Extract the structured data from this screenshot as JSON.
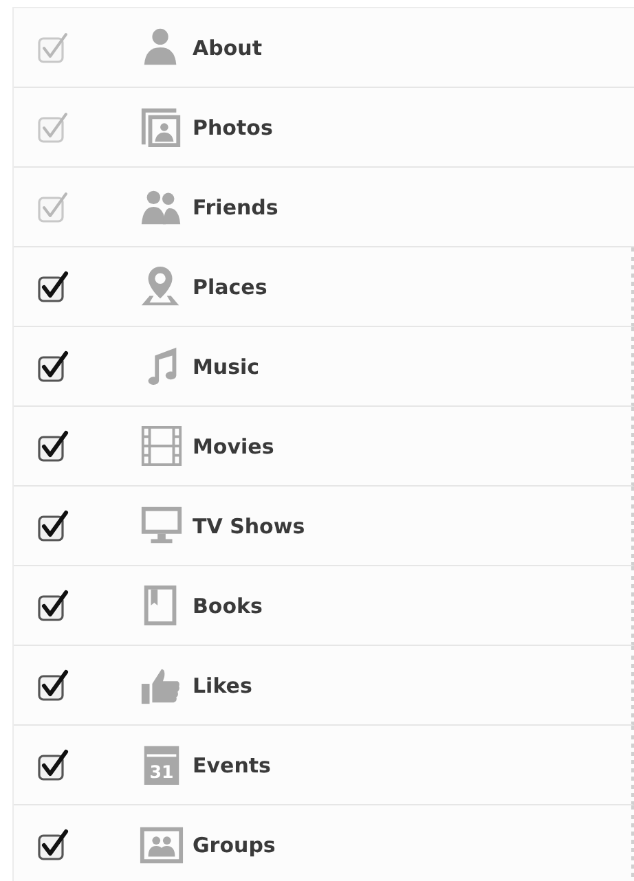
{
  "items": [
    {
      "label": "About",
      "checked": true,
      "disabled": true
    },
    {
      "label": "Photos",
      "checked": true,
      "disabled": true
    },
    {
      "label": "Friends",
      "checked": true,
      "disabled": true
    },
    {
      "label": "Places",
      "checked": true,
      "disabled": false
    },
    {
      "label": "Music",
      "checked": true,
      "disabled": false
    },
    {
      "label": "Movies",
      "checked": true,
      "disabled": false
    },
    {
      "label": "TV Shows",
      "checked": true,
      "disabled": false
    },
    {
      "label": "Books",
      "checked": true,
      "disabled": false
    },
    {
      "label": "Likes",
      "checked": true,
      "disabled": false
    },
    {
      "label": "Events",
      "checked": true,
      "disabled": false,
      "icon_label": "31"
    },
    {
      "label": "Groups",
      "checked": true,
      "disabled": false
    }
  ]
}
